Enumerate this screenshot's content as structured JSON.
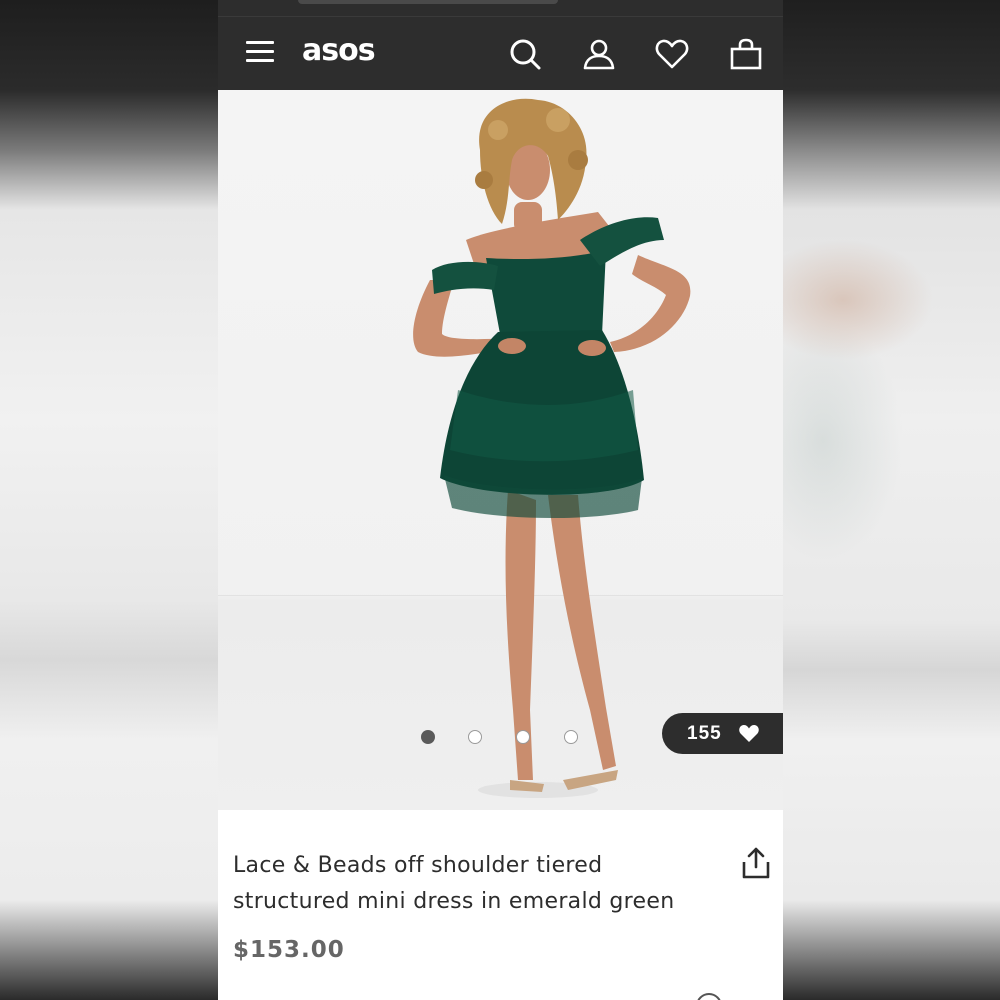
{
  "header": {
    "menu_icon": "hamburger-menu-icon",
    "logo": "asos",
    "icons": [
      "search-icon",
      "account-icon",
      "heart-icon",
      "shopping-bag-icon"
    ]
  },
  "product": {
    "image_alt": "Model wearing emerald green tiered tulle mini dress",
    "carousel": {
      "total": 4,
      "active_index": 0
    },
    "likes": {
      "count": "155",
      "icon": "heart-icon"
    },
    "title": "Lace & Beads off shoulder tiered structured mini dress in emerald green",
    "price": "$153.00",
    "share_icon": "share-icon"
  },
  "colors": {
    "header_bg": "#2d2d2d",
    "dress": "#0f4a3a",
    "text": "#2d2d2d",
    "price": "#666666"
  }
}
